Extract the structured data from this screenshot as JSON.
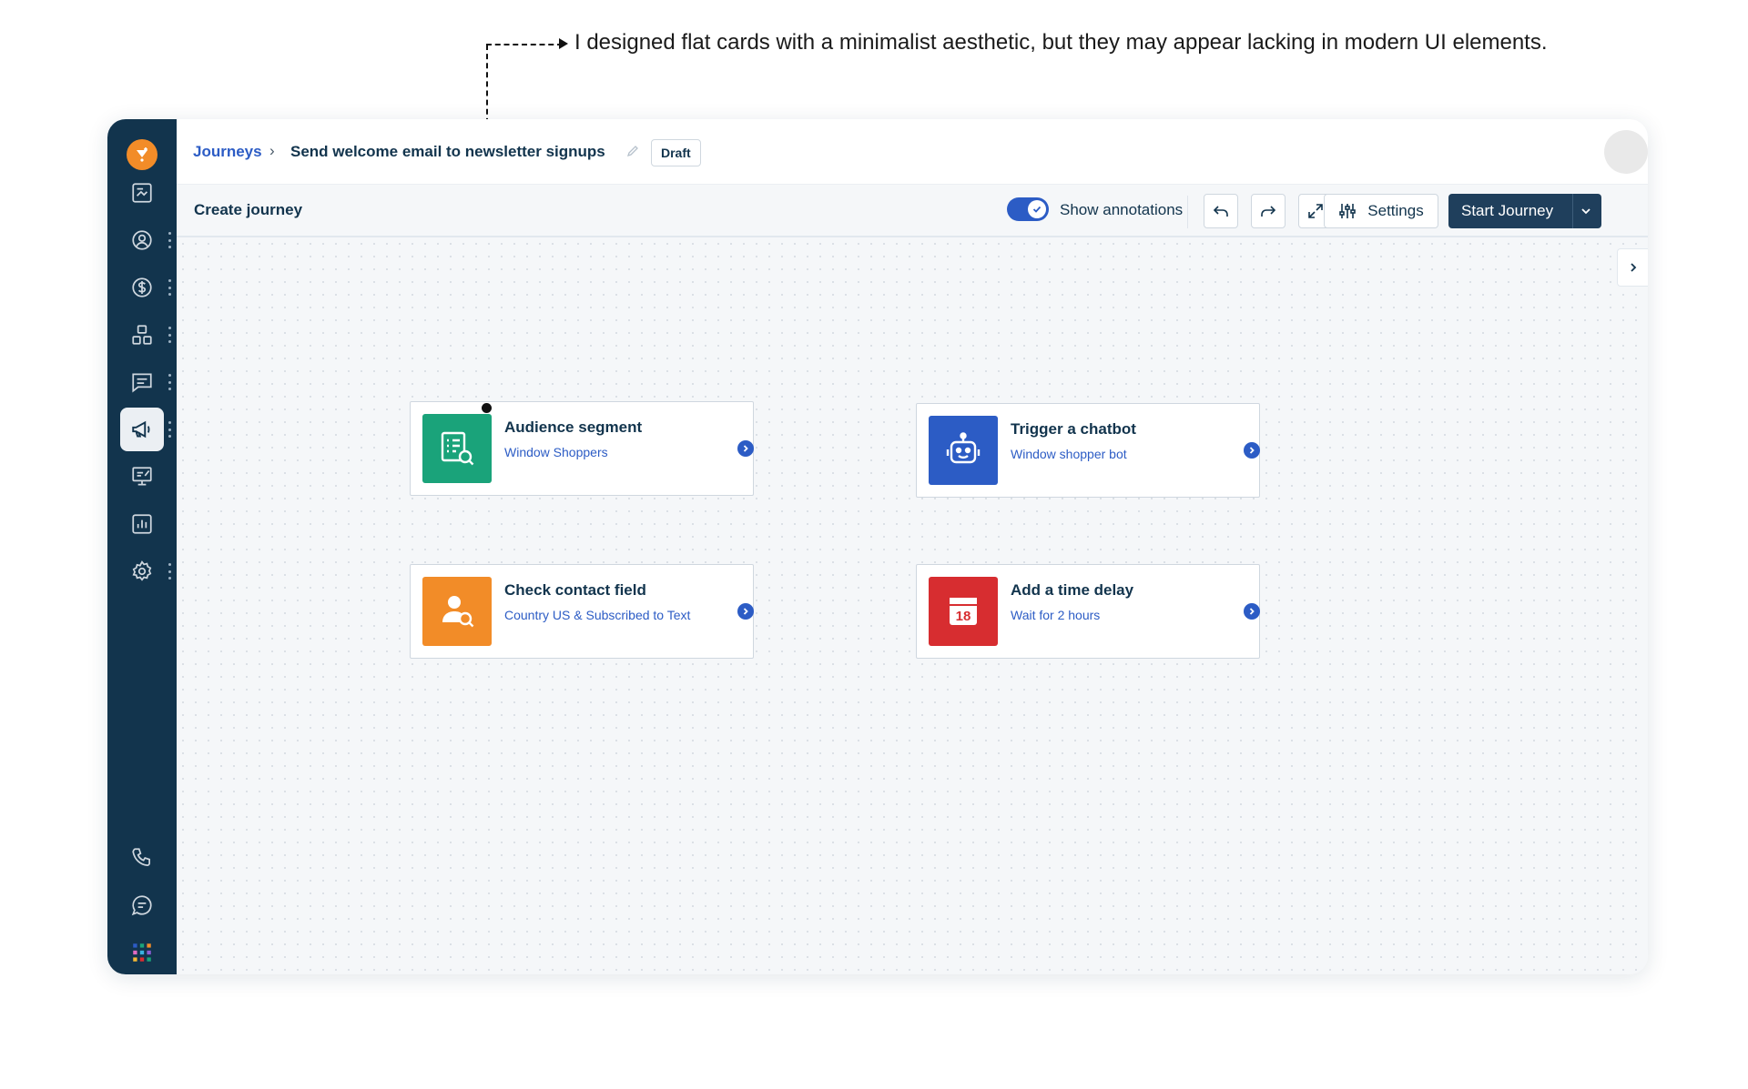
{
  "annotation": {
    "text": "I designed flat cards with a minimalist aesthetic, but they may appear lacking in modern UI elements."
  },
  "breadcrumb": {
    "root": "Journeys",
    "separator": "›",
    "title": "Send welcome email to newsletter signups",
    "status_badge": "Draft"
  },
  "toolbar": {
    "title": "Create journey",
    "toggle_label": "Show annotations",
    "toggle_on": true,
    "settings_label": "Settings",
    "start_label": "Start Journey"
  },
  "sidebar": {
    "items": [
      {
        "icon": "dashboard-icon"
      },
      {
        "icon": "contacts-icon",
        "more": true
      },
      {
        "icon": "deals-icon",
        "more": true
      },
      {
        "icon": "apps-grid-icon",
        "more": true
      },
      {
        "icon": "messages-icon",
        "more": true
      },
      {
        "icon": "campaigns-megaphone-icon",
        "more": true,
        "active": true
      },
      {
        "icon": "web-forms-icon"
      },
      {
        "icon": "reports-icon"
      },
      {
        "icon": "settings-gear-icon",
        "more": true
      }
    ],
    "bottom_items": [
      {
        "icon": "phone-icon"
      },
      {
        "icon": "chat-icon"
      },
      {
        "icon": "app-switcher-icon"
      }
    ]
  },
  "cards": [
    {
      "title": "Audience segment",
      "subtitle": "Window Shoppers",
      "color": "#1aa37a",
      "icon": "segment-icon"
    },
    {
      "title": "Trigger a chatbot",
      "subtitle": "Window shopper bot",
      "color": "#2c5cc5",
      "icon": "chatbot-icon"
    },
    {
      "title": "Check contact field",
      "subtitle": "Country US & Subscribed to Text",
      "color": "#f28c28",
      "icon": "contact-search-icon"
    },
    {
      "title": "Add a time delay",
      "subtitle": "Wait for 2 hours",
      "color": "#d72d30",
      "icon": "calendar-icon",
      "icon_text": "18"
    }
  ],
  "colors": {
    "sidebar": "#12344d",
    "accent": "#2c5cc5",
    "brand": "#f28c28"
  }
}
